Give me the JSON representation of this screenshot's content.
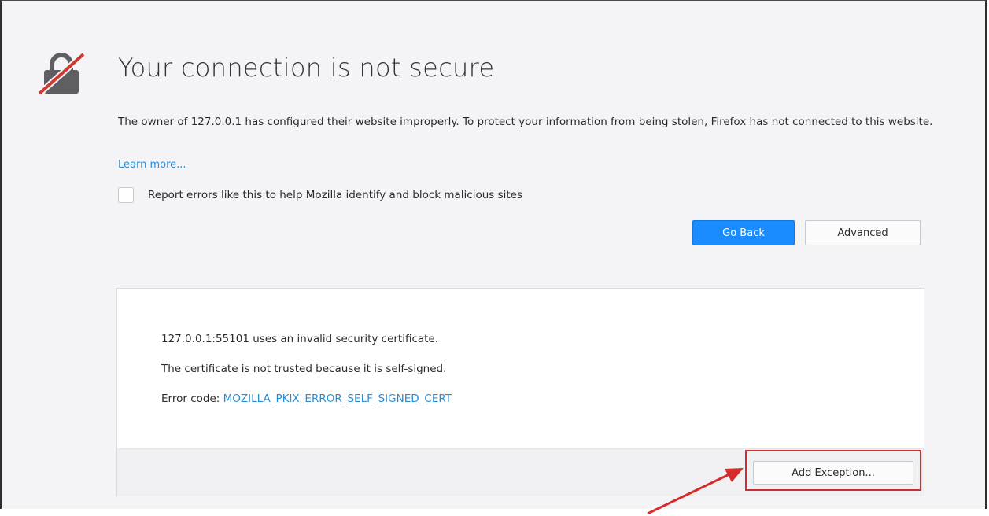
{
  "page": {
    "title": "Your connection is not secure",
    "description": "The owner of 127.0.0.1 has configured their website improperly. To protect your information from being stolen, Firefox has not connected to this website.",
    "learn_more": "Learn more...",
    "report_label": "Report errors like this to help Mozilla identify and block malicious sites",
    "report_checked": false,
    "icon": "broken-lock-icon"
  },
  "buttons": {
    "go_back": "Go Back",
    "advanced": "Advanced",
    "add_exception": "Add Exception..."
  },
  "advanced_panel": {
    "invalid_cert": "127.0.0.1:55101 uses an invalid security certificate.",
    "not_trusted": "The certificate is not trusted because it is self-signed.",
    "error_label": "Error code: ",
    "error_code": "MOZILLA_PKIX_ERROR_SELF_SIGNED_CERT"
  },
  "colors": {
    "primary_button": "#1a8cff",
    "link": "#2a8dd4",
    "annotation_red": "#cc2e2e",
    "background": "#f4f4f7"
  }
}
